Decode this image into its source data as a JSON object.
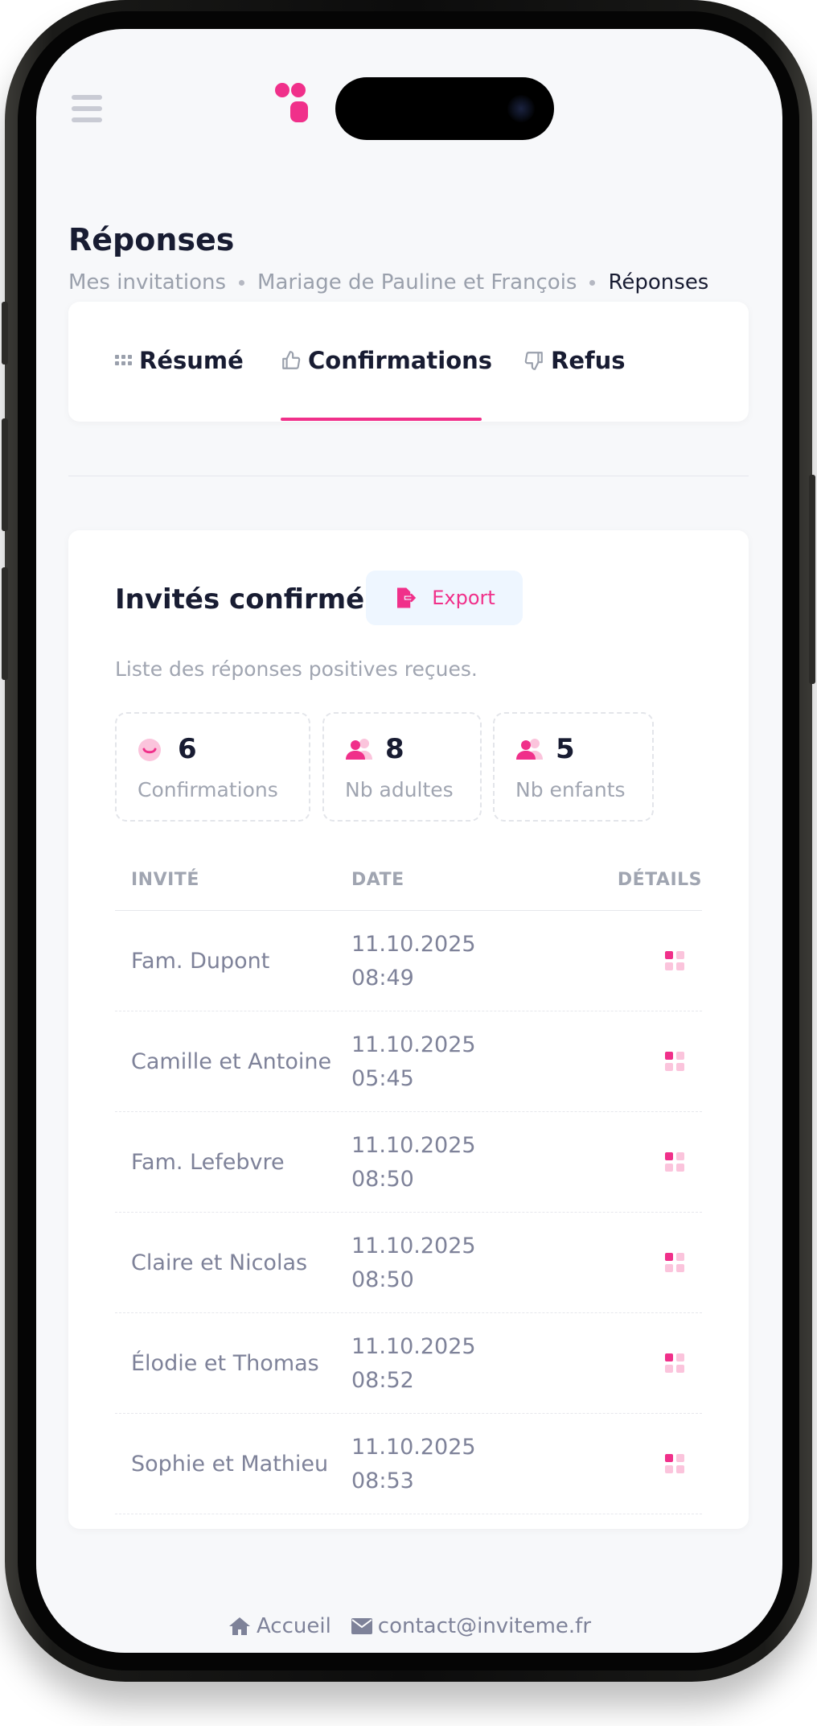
{
  "header": {
    "page_title": "Réponses",
    "breadcrumb": [
      "Mes invitations",
      "Mariage de Pauline et François",
      "Réponses"
    ]
  },
  "tabs": [
    {
      "label": "Résumé",
      "icon": "grid-icon"
    },
    {
      "label": "Confirmations",
      "icon": "thumbs-up-icon",
      "active": true
    },
    {
      "label": "Refus",
      "icon": "thumbs-down-icon"
    }
  ],
  "card": {
    "title": "Invités confirmés",
    "export_label": "Export",
    "subtitle": "Liste des réponses positives reçues."
  },
  "stats": [
    {
      "value": "6",
      "label": "Confirmations",
      "icon": "smile-icon"
    },
    {
      "value": "8",
      "label": "Nb adultes",
      "icon": "users-icon"
    },
    {
      "value": "5",
      "label": "Nb enfants",
      "icon": "users-icon"
    }
  ],
  "table": {
    "columns": [
      "INVITÉ",
      "DATE",
      "DÉTAILS"
    ],
    "rows": [
      {
        "guest": "Fam. Dupont",
        "date": "11.10.2025",
        "time": "08:49"
      },
      {
        "guest": "Camille et Antoine",
        "date": "11.10.2025",
        "time": "05:45"
      },
      {
        "guest": "Fam. Lefebvre",
        "date": "11.10.2025",
        "time": "08:50"
      },
      {
        "guest": "Claire et Nicolas",
        "date": "11.10.2025",
        "time": "08:50"
      },
      {
        "guest": "Élodie et Thomas",
        "date": "11.10.2025",
        "time": "08:52"
      },
      {
        "guest": "Sophie et Mathieu",
        "date": "11.10.2025",
        "time": "08:53"
      }
    ]
  },
  "footer": {
    "home_label": "Accueil",
    "email": "contact@inviteme.fr"
  },
  "colors": {
    "accent": "#f0308a",
    "text_dark": "#181c32",
    "text_muted": "#a0a5b1",
    "background": "#f7f8fa"
  }
}
